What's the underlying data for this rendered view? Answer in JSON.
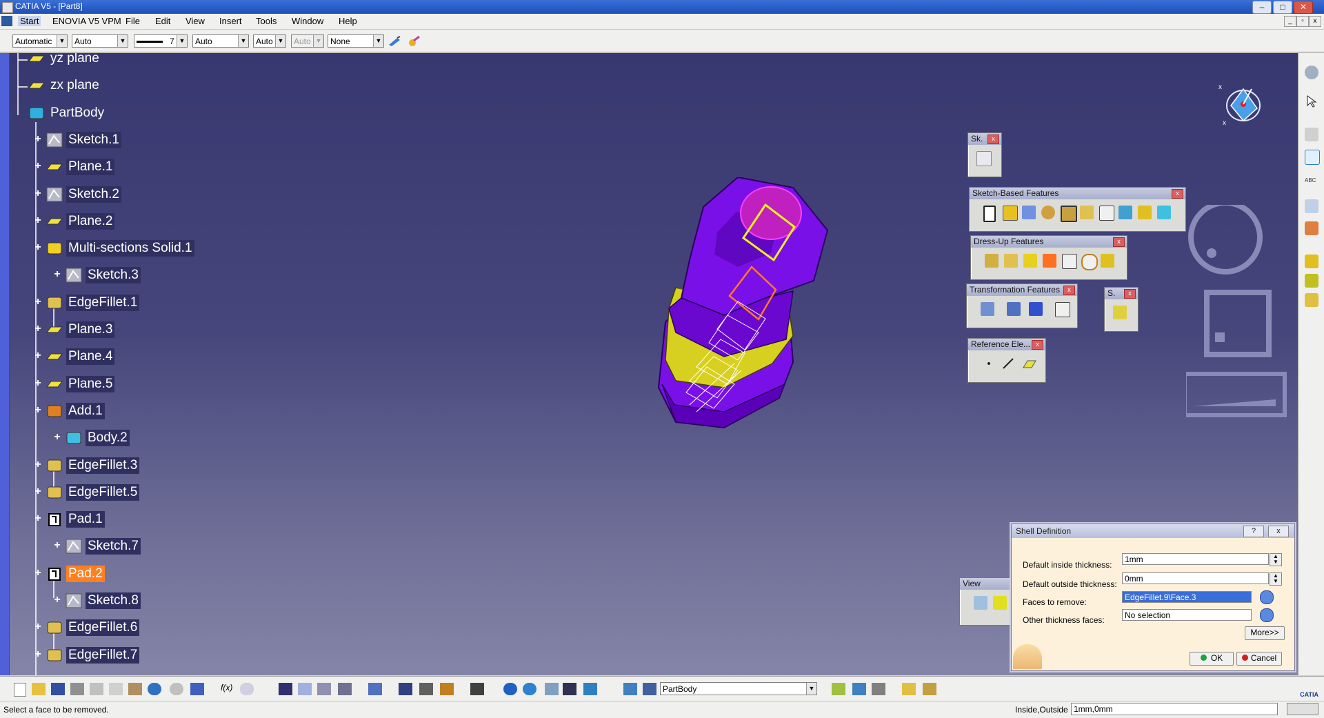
{
  "window": {
    "title": "CATIA V5 - [Part8]"
  },
  "menu": [
    "Start",
    "ENOVIA V5 VPM",
    "File",
    "Edit",
    "View",
    "Insert",
    "Tools",
    "Window",
    "Help"
  ],
  "graphic_properties": {
    "color": "Automatic",
    "transparency": "Auto",
    "line_weight": "7",
    "line_type": "Auto",
    "point_type": "Auto",
    "layer_disabled": "Auto",
    "layer": "None"
  },
  "tree": [
    {
      "label": "yz plane",
      "icon": "plane-icon",
      "level": 0
    },
    {
      "label": "zx plane",
      "icon": "plane-icon",
      "level": 0
    },
    {
      "label": "PartBody",
      "icon": "partbody-icon",
      "level": 0
    },
    {
      "label": "Sketch.1",
      "icon": "sketch-icon",
      "level": 1
    },
    {
      "label": "Plane.1",
      "icon": "plane-icon",
      "level": 1
    },
    {
      "label": "Sketch.2",
      "icon": "sketch-icon",
      "level": 1
    },
    {
      "label": "Plane.2",
      "icon": "plane-icon",
      "level": 1
    },
    {
      "label": "Multi-sections Solid.1",
      "icon": "multisection-icon",
      "level": 1
    },
    {
      "label": "Sketch.3",
      "icon": "sketch-icon",
      "level": 2
    },
    {
      "label": "EdgeFillet.1",
      "icon": "edgefillet-icon",
      "level": 1
    },
    {
      "label": "Plane.3",
      "icon": "plane-icon",
      "level": 1
    },
    {
      "label": "Plane.4",
      "icon": "plane-icon",
      "level": 1
    },
    {
      "label": "Plane.5",
      "icon": "plane-icon",
      "level": 1
    },
    {
      "label": "Add.1",
      "icon": "add-icon",
      "level": 1
    },
    {
      "label": "Body.2",
      "icon": "body-icon",
      "level": 2
    },
    {
      "label": "EdgeFillet.3",
      "icon": "edgefillet-icon",
      "level": 1
    },
    {
      "label": "EdgeFillet.5",
      "icon": "edgefillet-icon",
      "level": 1
    },
    {
      "label": "Pad.1",
      "icon": "pad-icon",
      "level": 1
    },
    {
      "label": "Sketch.7",
      "icon": "sketch-icon",
      "level": 2
    },
    {
      "label": "Pad.2",
      "icon": "pad-icon",
      "level": 1,
      "selected": true
    },
    {
      "label": "Sketch.8",
      "icon": "sketch-icon",
      "level": 2
    },
    {
      "label": "EdgeFillet.6",
      "icon": "edgefillet-icon",
      "level": 1
    },
    {
      "label": "EdgeFillet.7",
      "icon": "edgefillet-icon",
      "level": 1
    }
  ],
  "toolbars": {
    "sketcher": {
      "title": "Sk."
    },
    "sketch_based": {
      "title": "Sketch-Based Features"
    },
    "dress_up": {
      "title": "Dress-Up Features"
    },
    "transformation": {
      "title": "Transformation Features"
    },
    "surface": {
      "title": "S."
    },
    "reference": {
      "title": "Reference Ele..."
    },
    "view": {
      "title": "View"
    }
  },
  "dialog": {
    "title": "Shell Definition",
    "help": "?",
    "close": "x",
    "inside_label": "Default inside thickness:",
    "inside_value": "1mm",
    "outside_label": "Default outside thickness:",
    "outside_value": "0mm",
    "faces_label": "Faces to remove:",
    "faces_value": "EdgeFillet.9\\Face.3",
    "other_label": "Other thickness faces:",
    "other_value": "No selection",
    "more": "More>>",
    "ok": "OK",
    "cancel": "Cancel"
  },
  "bottom": {
    "current_body": "PartBody",
    "brand": "CATIA"
  },
  "status": {
    "message": "Select a face to be removed.",
    "prompt_label": "Inside,Outside",
    "prompt_value": "1mm,0mm"
  },
  "colors": {
    "background_top": "#383870",
    "background_bottom": "#8585a8",
    "part": "#7a10e8",
    "highlight": "#e8e020",
    "selection": "#ff8020"
  }
}
